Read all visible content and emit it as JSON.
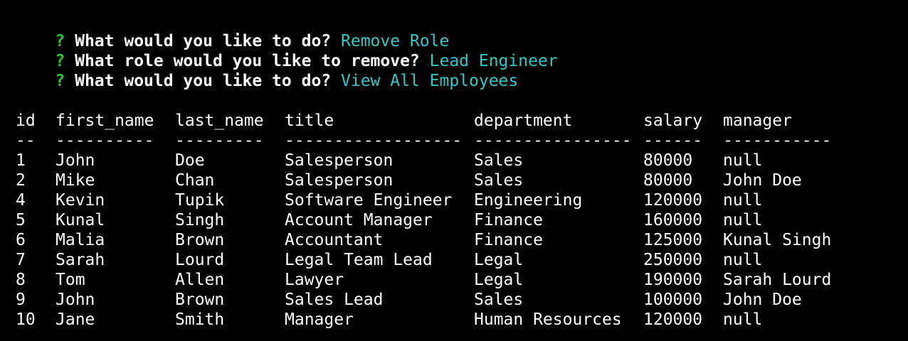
{
  "prompts": [
    {
      "mark": "?",
      "question": "What would you like to do?",
      "answer": "Remove Role"
    },
    {
      "mark": "?",
      "question": "What role would you like to remove?",
      "answer": "Lead Engineer"
    },
    {
      "mark": "?",
      "question": "What would you like to do?",
      "answer": "View All Employees"
    }
  ],
  "table": {
    "headers": [
      "id",
      "first_name",
      "last_name",
      "title",
      "department",
      "salary",
      "manager"
    ],
    "separators": [
      "--",
      "----------",
      "---------",
      "------------------",
      "----------------",
      "------",
      "-----------"
    ],
    "rows": [
      [
        "1",
        "John",
        "Doe",
        "Salesperson",
        "Sales",
        "80000",
        "null"
      ],
      [
        "2",
        "Mike",
        "Chan",
        "Salesperson",
        "Sales",
        "80000",
        "John Doe"
      ],
      [
        "4",
        "Kevin",
        "Tupik",
        "Software Engineer",
        "Engineering",
        "120000",
        "null"
      ],
      [
        "5",
        "Kunal",
        "Singh",
        "Account Manager",
        "Finance",
        "160000",
        "null"
      ],
      [
        "6",
        "Malia",
        "Brown",
        "Accountant",
        "Finance",
        "125000",
        "Kunal Singh"
      ],
      [
        "7",
        "Sarah",
        "Lourd",
        "Legal Team Lead",
        "Legal",
        "250000",
        "null"
      ],
      [
        "8",
        "Tom",
        "Allen",
        "Lawyer",
        "Legal",
        "190000",
        "Sarah Lourd"
      ],
      [
        "9",
        "John",
        "Brown",
        "Sales Lead",
        "Sales",
        "100000",
        "John Doe"
      ],
      [
        "10",
        "Jane",
        "Smith",
        "Manager",
        "Human Resources",
        "120000",
        "null"
      ]
    ]
  },
  "colors": {
    "background": "#000000",
    "prompt_mark": "#2ec22e",
    "answer": "#2cc9c9",
    "text": "#ffffff"
  }
}
